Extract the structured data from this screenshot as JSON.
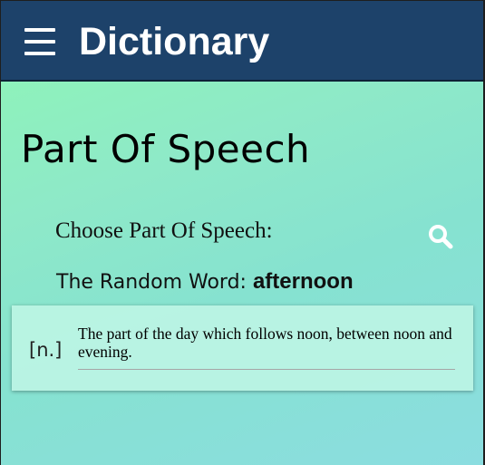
{
  "header": {
    "title": "Dictionary",
    "menu_icon": "hamburger-menu-icon"
  },
  "page": {
    "title": "Part Of Speech"
  },
  "search": {
    "label": "Choose Part Of Speech:",
    "icon": "search-icon"
  },
  "random_word": {
    "label": "The Random Word: ",
    "word": "afternoon"
  },
  "definition": {
    "part_of_speech": "[n.]",
    "text": "The part of the day which follows noon, between noon and evening."
  },
  "colors": {
    "header_bg": "#1d426a",
    "gradient_start": "#8ff7b4",
    "gradient_end": "#8bdde0",
    "card_bg": "#bef5e4"
  }
}
